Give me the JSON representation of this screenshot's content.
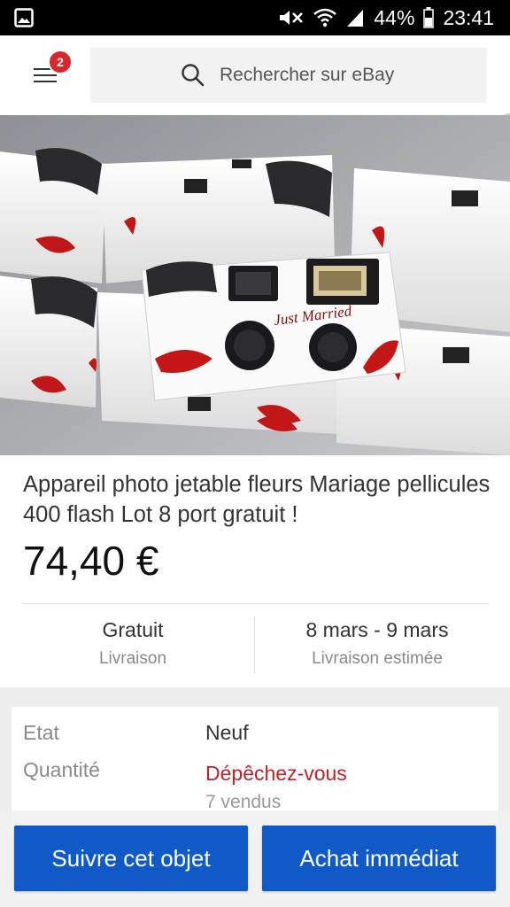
{
  "status_bar": {
    "battery": "44%",
    "time": "23:41",
    "icons": [
      "gallery-icon",
      "mute-icon",
      "wifi-icon",
      "signal-icon",
      "battery-icon"
    ]
  },
  "header": {
    "menu_badge": "2",
    "search_placeholder": "Rechercher sur eBay"
  },
  "product": {
    "image_caption": "Just Married",
    "title": "Appareil photo jetable fleurs Mariage pellicules 400 flash Lot 8 port gratuit !",
    "price": "74,40 €"
  },
  "shipping": {
    "cost_value": "Gratuit",
    "cost_label": "Livraison",
    "estimate_value": "8 mars - 9 mars",
    "estimate_label": "Livraison estimée"
  },
  "details": {
    "condition_label": "Etat",
    "condition_value": "Neuf",
    "quantity_label": "Quantité",
    "quantity_value": "Dépêchez-vous",
    "sold_count": "7 vendus"
  },
  "actions": {
    "watch_label": "Suivre cet objet",
    "buy_label": "Achat immédiat"
  },
  "colors": {
    "primary_button": "#0f5ac8",
    "badge": "#d8262c",
    "urgent_text": "#b8232c"
  }
}
